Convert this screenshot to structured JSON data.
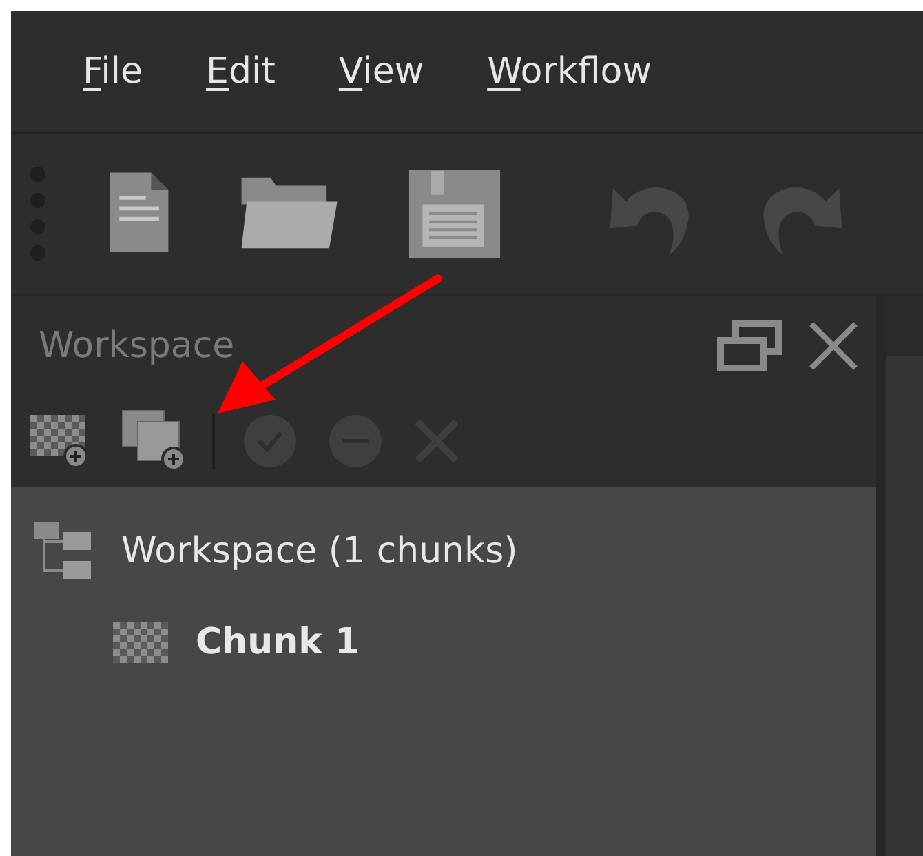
{
  "menu": [
    {
      "accel": "F",
      "rest": "ile"
    },
    {
      "accel": "E",
      "rest": "dit"
    },
    {
      "accel": "V",
      "rest": "iew"
    },
    {
      "accel": "W",
      "rest": "orkflow"
    }
  ],
  "toolbar": [
    {
      "kind": "new",
      "disabled": false
    },
    {
      "kind": "open",
      "disabled": false
    },
    {
      "kind": "save",
      "disabled": false
    },
    {
      "kind": "sep"
    },
    {
      "kind": "undo",
      "disabled": true
    },
    {
      "kind": "redo",
      "disabled": true
    },
    {
      "kind": "sep"
    }
  ],
  "workspace": {
    "title": "Workspace",
    "tools": [
      {
        "kind": "add-chunk",
        "disabled": false
      },
      {
        "kind": "add-photos",
        "disabled": false
      },
      {
        "kind": "sep"
      },
      {
        "kind": "enable",
        "disabled": true
      },
      {
        "kind": "disable",
        "disabled": true
      },
      {
        "kind": "remove",
        "disabled": true
      }
    ],
    "tree": [
      {
        "label": "Workspace (1 chunks)",
        "kind": "workspace",
        "active": false,
        "children": [
          {
            "label": "Chunk 1",
            "kind": "chunk",
            "active": true
          }
        ]
      }
    ]
  }
}
